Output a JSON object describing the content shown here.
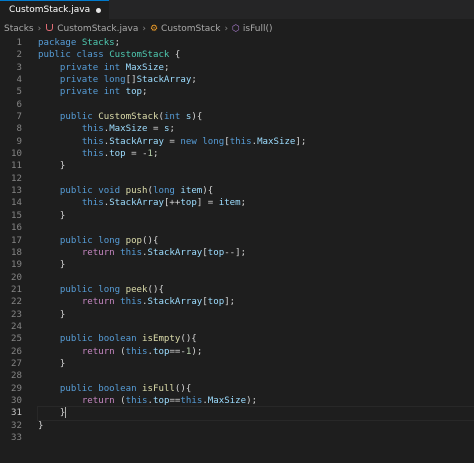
{
  "tab": {
    "title": "CustomStack.java"
  },
  "breadcrumb": {
    "folder": "Stacks",
    "file": "CustomStack.java",
    "class": "CustomStack",
    "method": "isFull()"
  },
  "editor": {
    "active_line": 31,
    "lines": [
      {
        "n": "1",
        "t": [
          [
            "kw",
            "package "
          ],
          [
            "ty",
            "Stacks"
          ],
          [
            "pl",
            ";"
          ]
        ]
      },
      {
        "n": "2",
        "t": [
          [
            "kw",
            "public class "
          ],
          [
            "ty",
            "CustomStack"
          ],
          [
            "pl",
            " {"
          ]
        ]
      },
      {
        "n": "3",
        "t": [
          [
            "pl",
            "    "
          ],
          [
            "kw",
            "private int "
          ],
          [
            "id",
            "MaxSize"
          ],
          [
            "pl",
            ";"
          ]
        ]
      },
      {
        "n": "4",
        "t": [
          [
            "pl",
            "    "
          ],
          [
            "kw",
            "private long"
          ],
          [
            "pl",
            "[]"
          ],
          [
            "id",
            "StackArray"
          ],
          [
            "pl",
            ";"
          ]
        ]
      },
      {
        "n": "5",
        "t": [
          [
            "pl",
            "    "
          ],
          [
            "kw",
            "private int "
          ],
          [
            "id",
            "top"
          ],
          [
            "pl",
            ";"
          ]
        ]
      },
      {
        "n": "6",
        "t": []
      },
      {
        "n": "7",
        "t": [
          [
            "pl",
            "    "
          ],
          [
            "kw",
            "public "
          ],
          [
            "fn",
            "CustomStack"
          ],
          [
            "pl",
            "("
          ],
          [
            "kw",
            "int "
          ],
          [
            "id",
            "s"
          ],
          [
            "pl",
            "){"
          ]
        ]
      },
      {
        "n": "8",
        "t": [
          [
            "pl",
            "        "
          ],
          [
            "kw",
            "this"
          ],
          [
            "pl",
            "."
          ],
          [
            "id",
            "MaxSize"
          ],
          [
            "pl",
            " = "
          ],
          [
            "id",
            "s"
          ],
          [
            "pl",
            ";"
          ]
        ]
      },
      {
        "n": "9",
        "t": [
          [
            "pl",
            "        "
          ],
          [
            "kw",
            "this"
          ],
          [
            "pl",
            "."
          ],
          [
            "id",
            "StackArray"
          ],
          [
            "pl",
            " = "
          ],
          [
            "kw",
            "new long"
          ],
          [
            "pl",
            "["
          ],
          [
            "kw",
            "this"
          ],
          [
            "pl",
            "."
          ],
          [
            "id",
            "MaxSize"
          ],
          [
            "pl",
            "];"
          ]
        ]
      },
      {
        "n": "10",
        "t": [
          [
            "pl",
            "        "
          ],
          [
            "kw",
            "this"
          ],
          [
            "pl",
            "."
          ],
          [
            "id",
            "top"
          ],
          [
            "pl",
            " = -"
          ],
          [
            "num",
            "1"
          ],
          [
            "pl",
            ";"
          ]
        ]
      },
      {
        "n": "11",
        "t": [
          [
            "pl",
            "    }"
          ]
        ]
      },
      {
        "n": "12",
        "t": []
      },
      {
        "n": "13",
        "t": [
          [
            "pl",
            "    "
          ],
          [
            "kw",
            "public void "
          ],
          [
            "fn",
            "push"
          ],
          [
            "pl",
            "("
          ],
          [
            "kw",
            "long "
          ],
          [
            "id",
            "item"
          ],
          [
            "pl",
            "){"
          ]
        ]
      },
      {
        "n": "14",
        "t": [
          [
            "pl",
            "        "
          ],
          [
            "kw",
            "this"
          ],
          [
            "pl",
            "."
          ],
          [
            "id",
            "StackArray"
          ],
          [
            "pl",
            "[++"
          ],
          [
            "id",
            "top"
          ],
          [
            "pl",
            "] = "
          ],
          [
            "id",
            "item"
          ],
          [
            "pl",
            ";"
          ]
        ]
      },
      {
        "n": "15",
        "t": [
          [
            "pl",
            "    }"
          ]
        ]
      },
      {
        "n": "16",
        "t": []
      },
      {
        "n": "17",
        "t": [
          [
            "pl",
            "    "
          ],
          [
            "kw",
            "public long "
          ],
          [
            "fn",
            "pop"
          ],
          [
            "pl",
            "(){"
          ]
        ]
      },
      {
        "n": "18",
        "t": [
          [
            "pl",
            "        "
          ],
          [
            "kwc",
            "return "
          ],
          [
            "kw",
            "this"
          ],
          [
            "pl",
            "."
          ],
          [
            "id",
            "StackArray"
          ],
          [
            "pl",
            "["
          ],
          [
            "id",
            "top"
          ],
          [
            "pl",
            "--];"
          ]
        ]
      },
      {
        "n": "19",
        "t": [
          [
            "pl",
            "    }"
          ]
        ]
      },
      {
        "n": "20",
        "t": []
      },
      {
        "n": "21",
        "t": [
          [
            "pl",
            "    "
          ],
          [
            "kw",
            "public long "
          ],
          [
            "fn",
            "peek"
          ],
          [
            "pl",
            "(){"
          ]
        ]
      },
      {
        "n": "22",
        "t": [
          [
            "pl",
            "        "
          ],
          [
            "kwc",
            "return "
          ],
          [
            "kw",
            "this"
          ],
          [
            "pl",
            "."
          ],
          [
            "id",
            "StackArray"
          ],
          [
            "pl",
            "["
          ],
          [
            "id",
            "top"
          ],
          [
            "pl",
            "];"
          ]
        ]
      },
      {
        "n": "23",
        "t": [
          [
            "pl",
            "    }"
          ]
        ]
      },
      {
        "n": "24",
        "t": []
      },
      {
        "n": "25",
        "t": [
          [
            "pl",
            "    "
          ],
          [
            "kw",
            "public boolean "
          ],
          [
            "fn",
            "isEmpty"
          ],
          [
            "pl",
            "(){"
          ]
        ]
      },
      {
        "n": "26",
        "t": [
          [
            "pl",
            "        "
          ],
          [
            "kwc",
            "return "
          ],
          [
            "pl",
            "("
          ],
          [
            "kw",
            "this"
          ],
          [
            "pl",
            "."
          ],
          [
            "id",
            "top"
          ],
          [
            "pl",
            "==-"
          ],
          [
            "num",
            "1"
          ],
          [
            "pl",
            ");"
          ]
        ]
      },
      {
        "n": "27",
        "t": [
          [
            "pl",
            "    }"
          ]
        ]
      },
      {
        "n": "28",
        "t": []
      },
      {
        "n": "29",
        "t": [
          [
            "pl",
            "    "
          ],
          [
            "kw",
            "public boolean "
          ],
          [
            "fn",
            "isFull"
          ],
          [
            "pl",
            "(){"
          ]
        ]
      },
      {
        "n": "30",
        "t": [
          [
            "pl",
            "        "
          ],
          [
            "kwc",
            "return "
          ],
          [
            "pl",
            "("
          ],
          [
            "kw",
            "this"
          ],
          [
            "pl",
            "."
          ],
          [
            "id",
            "top"
          ],
          [
            "pl",
            "=="
          ],
          [
            "kw",
            "this"
          ],
          [
            "pl",
            "."
          ],
          [
            "id",
            "MaxSize"
          ],
          [
            "pl",
            ");"
          ]
        ]
      },
      {
        "n": "31",
        "t": [
          [
            "pl",
            "    }"
          ]
        ]
      },
      {
        "n": "32",
        "t": [
          [
            "pl",
            "}"
          ]
        ]
      },
      {
        "n": "33",
        "t": []
      }
    ]
  }
}
